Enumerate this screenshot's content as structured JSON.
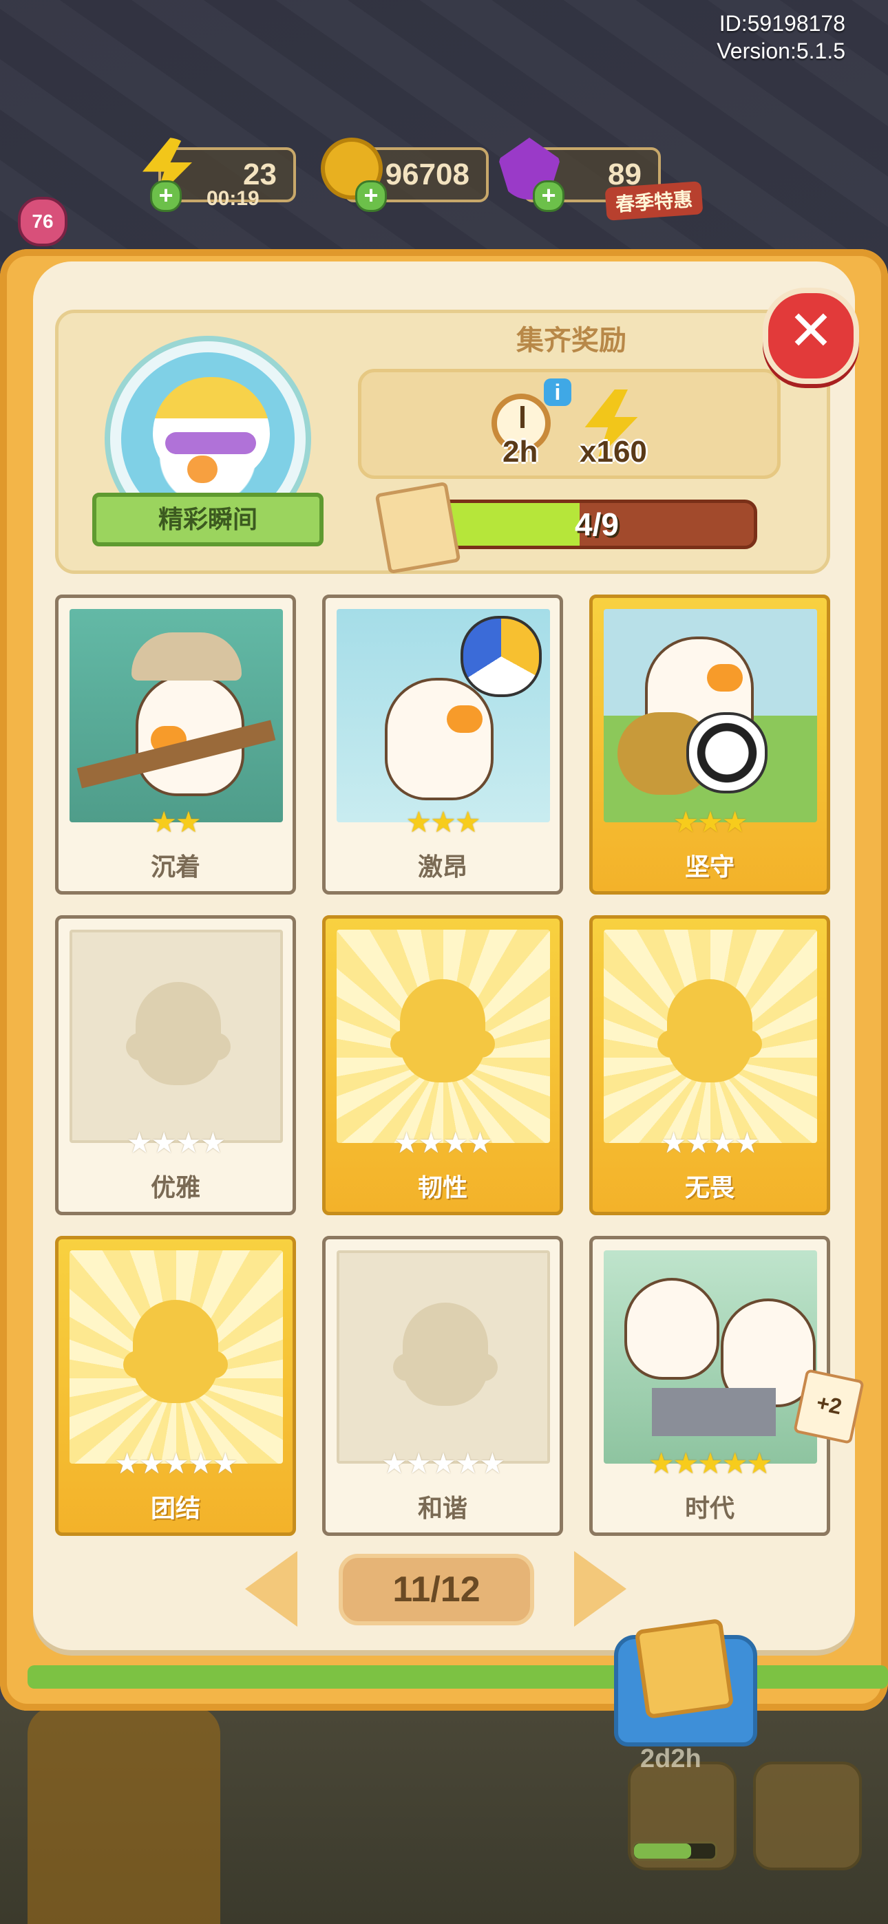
{
  "hud": {
    "id_text": "ID:59198178",
    "version_text": "Version:5.1.5",
    "level": "76",
    "energy": "23",
    "energy_timer": "00:19",
    "coins": "96708",
    "gems": "89",
    "promo": "春季特惠",
    "hud_plus": "+"
  },
  "header": {
    "emblem_label": "精彩瞬间",
    "reward_title": "集齐奖励",
    "reward_time": "2h",
    "reward_energy": "x160",
    "info": "i",
    "close": "✕"
  },
  "progress": {
    "collected": 4,
    "total": 9,
    "label": "4/9",
    "fraction": 0.444
  },
  "cards": [
    {
      "name": "沉着",
      "stars_on": 2,
      "stars_total": 2,
      "state": "collected",
      "rarity": "normal"
    },
    {
      "name": "激昂",
      "stars_on": 3,
      "stars_total": 3,
      "state": "collected",
      "rarity": "normal"
    },
    {
      "name": "坚守",
      "stars_on": 3,
      "stars_total": 3,
      "state": "collected",
      "rarity": "gold"
    },
    {
      "name": "优雅",
      "stars_on": 0,
      "stars_total": 4,
      "state": "locked",
      "rarity": "normal"
    },
    {
      "name": "韧性",
      "stars_on": 0,
      "stars_total": 4,
      "state": "locked",
      "rarity": "gold"
    },
    {
      "name": "无畏",
      "stars_on": 0,
      "stars_total": 4,
      "state": "locked",
      "rarity": "gold"
    },
    {
      "name": "团结",
      "stars_on": 0,
      "stars_total": 5,
      "state": "locked",
      "rarity": "gold"
    },
    {
      "name": "和谐",
      "stars_on": 0,
      "stars_total": 5,
      "state": "locked",
      "rarity": "normal"
    },
    {
      "name": "时代",
      "stars_on": 5,
      "stars_total": 5,
      "state": "collected",
      "rarity": "normal",
      "badge": "+2"
    }
  ],
  "pagination": {
    "label": "11/12"
  },
  "bottom": {
    "timer": "2d2h"
  },
  "colors": {
    "progress_fill": "#b6e63a",
    "progress_track": "#a24a2c",
    "close": "#e23a3a",
    "star_on": "#f7cc1c"
  },
  "icons": [
    "sack-icon",
    "lightning-icon",
    "coin-icon",
    "gem-icon",
    "clock-icon",
    "card-pack-icon",
    "close-icon",
    "arrow-left-icon",
    "arrow-right-icon"
  ]
}
